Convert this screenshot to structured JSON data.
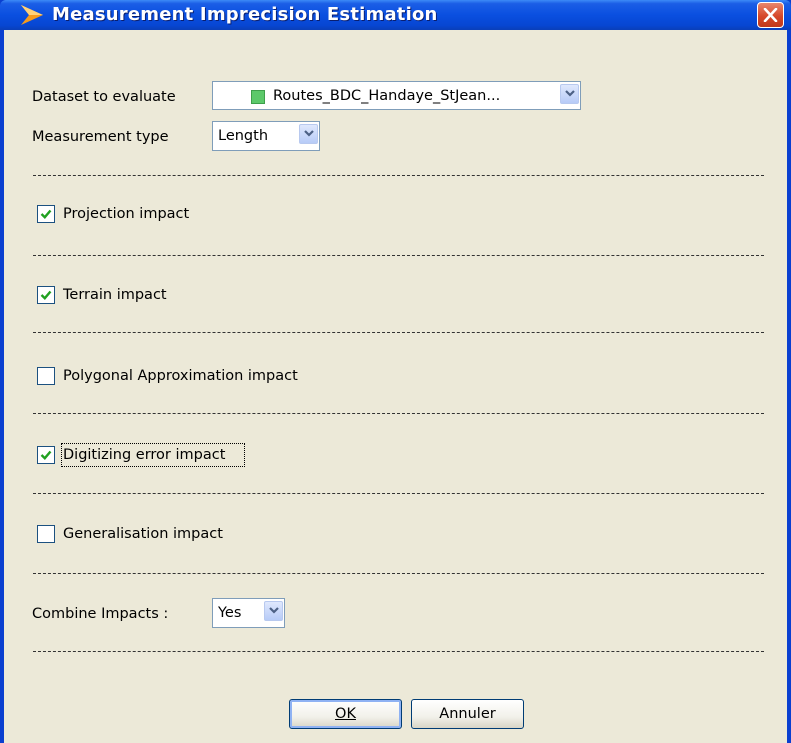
{
  "window": {
    "title": "Measurement Imprecision Estimation"
  },
  "dataset": {
    "label": "Dataset to evaluate",
    "value": "Routes_BDC_Handaye_StJean...",
    "swatch_color": "#5cc96a"
  },
  "measurement_type": {
    "label": "Measurement type",
    "value": "Length"
  },
  "impacts": [
    {
      "label": "Projection impact",
      "checked": true
    },
    {
      "label": "Terrain impact",
      "checked": true
    },
    {
      "label": "Polygonal Approximation impact",
      "checked": false
    },
    {
      "label": "Digitizing error impact",
      "checked": true
    },
    {
      "label": "Generalisation impact",
      "checked": false
    }
  ],
  "combine": {
    "label": "Combine Impacts :",
    "value": "Yes"
  },
  "buttons": {
    "ok": "OK",
    "cancel": "Annuler"
  },
  "colors": {
    "titlebar": "#0a4fe0",
    "dialog_bg": "#ece9d8",
    "check_mark": "#21a121"
  }
}
